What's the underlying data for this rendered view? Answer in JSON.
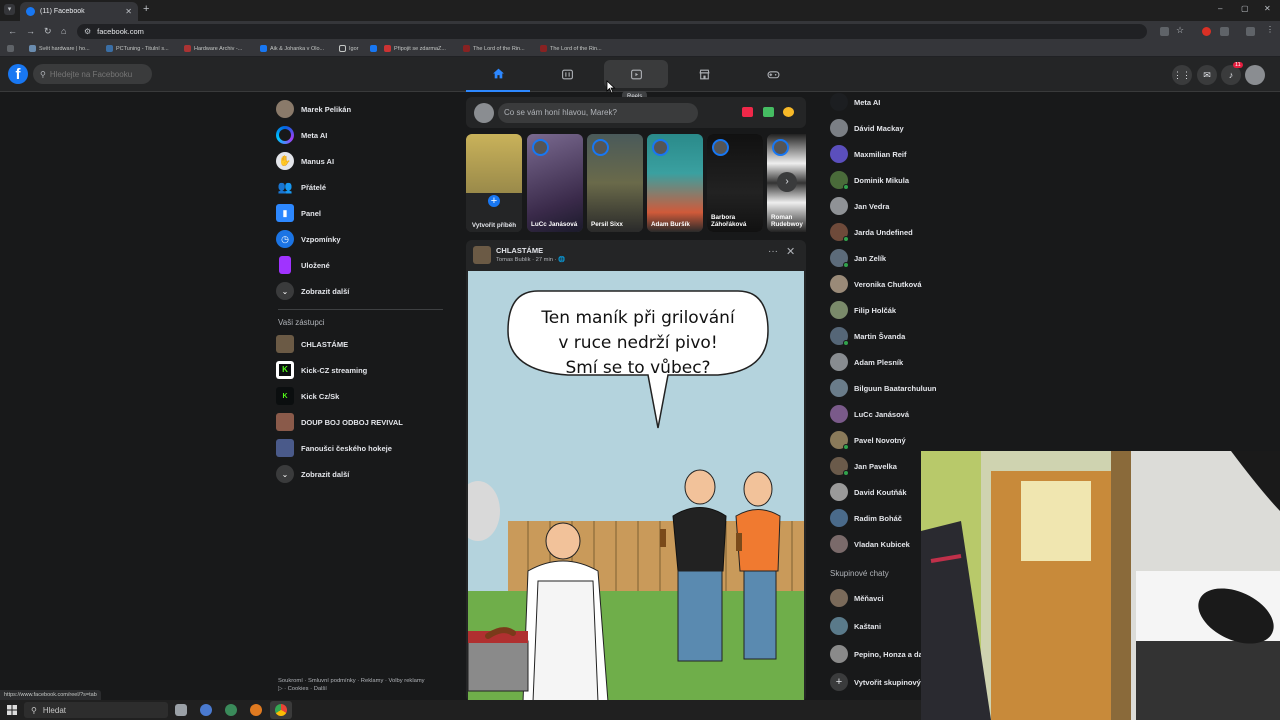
{
  "browser": {
    "tab_title": "(11) Facebook",
    "url": "facebook.com",
    "status_url": "https://www.facebook.com/reel/?s=tab",
    "bookmarks": [
      "Svět hardware | ho...",
      "PCTuning - Titulní s...",
      "Hardware Archiv -...",
      "Aik & Johanka v Olo...",
      "Igor",
      "Připojit se zdarmaZ...",
      "The Lord of the Rin...",
      "The Lord of the Rin..."
    ]
  },
  "header": {
    "search_placeholder": "Hledejte na Facebooku",
    "tooltip": "Reels",
    "notification_count": "11"
  },
  "left_nav": {
    "items": [
      {
        "label": "Marek Pelikán",
        "icon": "avatar"
      },
      {
        "label": "Meta AI",
        "icon": "meta-ai-icon"
      },
      {
        "label": "Manus AI",
        "icon": "manus-icon"
      },
      {
        "label": "Přátelé",
        "icon": "friends-icon"
      },
      {
        "label": "Panel",
        "icon": "panel-icon"
      },
      {
        "label": "Vzpomínky",
        "icon": "memories-icon"
      },
      {
        "label": "Uložené",
        "icon": "saved-icon"
      },
      {
        "label": "Zobrazit další",
        "icon": "chevron-down-icon"
      }
    ],
    "shortcuts_heading": "Vaši zástupci",
    "shortcuts": [
      {
        "label": "CHLASTÁME"
      },
      {
        "label": "Kick-CZ streaming"
      },
      {
        "label": "Kick Cz/Sk"
      },
      {
        "label": "DOUP BOJ ODBOJ REVIVAL"
      },
      {
        "label": "Fanoušci českého hokeje"
      },
      {
        "label": "Zobrazit další"
      }
    ],
    "footer": "Soukromí · Smluvní podmínky · Reklamy · Volby reklamy ▷ · Cookies · Další"
  },
  "composer": {
    "placeholder": "Co se vám honí hlavou, Marek?"
  },
  "stories": [
    {
      "name": "Vytvořit příběh"
    },
    {
      "name": "LuCc Janásová"
    },
    {
      "name": "Persil Sixx"
    },
    {
      "name": "Adam Buršík"
    },
    {
      "name": "Barbora Záhořáková"
    },
    {
      "name": "Roman Rudebwoy"
    }
  ],
  "post": {
    "group": "CHLASTÁME",
    "meta": "Tomas Bublik · 27 min · 🌐",
    "comic_lines": [
      "Ten maník při grilování",
      "v ruce nedrží pivo!",
      "Smí se to vůbec?"
    ]
  },
  "contacts": {
    "items": [
      {
        "name": "Meta AI",
        "online": false,
        "color": "#1c1e21"
      },
      {
        "name": "Dávid Mackay",
        "online": false,
        "color": "#7b7f85"
      },
      {
        "name": "Maxmilian Reif",
        "online": false,
        "color": "#5b4fbd"
      },
      {
        "name": "Dominik Mikula",
        "online": true,
        "color": "#4a6b3a"
      },
      {
        "name": "Jan Vedra",
        "online": false,
        "color": "#8f9296"
      },
      {
        "name": "Jarda Undefined",
        "online": true,
        "color": "#6e4a3a"
      },
      {
        "name": "Jan Zelík",
        "online": true,
        "color": "#5c6b7a"
      },
      {
        "name": "Veronika Chutková",
        "online": false,
        "color": "#9a8a78"
      },
      {
        "name": "Filip Holčák",
        "online": false,
        "color": "#7a8a6a"
      },
      {
        "name": "Martin Švanda",
        "online": true,
        "color": "#556677"
      },
      {
        "name": "Adam Plesník",
        "online": false,
        "color": "#888c90"
      },
      {
        "name": "Bilguun Baatarchuluun",
        "online": false,
        "color": "#6a7c8a"
      },
      {
        "name": "LuCc Janásová",
        "online": false,
        "color": "#7a5a8a"
      },
      {
        "name": "Pavel Novotný",
        "online": true,
        "color": "#8a7a5a"
      },
      {
        "name": "Jan Pavelka",
        "online": true,
        "color": "#6a5a4a"
      },
      {
        "name": "David Koutňák",
        "online": false,
        "color": "#9a9a9a"
      },
      {
        "name": "Radim Boháč",
        "online": false,
        "color": "#4a6a8a"
      },
      {
        "name": "Vladan Kubicek",
        "online": false,
        "color": "#7a6a6a"
      }
    ],
    "group_heading": "Skupinové chaty",
    "groups": [
      {
        "name": "Měňavci"
      },
      {
        "name": "Kaštani"
      },
      {
        "name": "Pepino, Honza a dal"
      },
      {
        "name": "Vytvořit skupinový c"
      }
    ]
  },
  "taskbar": {
    "search_placeholder": "Hledat"
  },
  "colors": {
    "fb_blue": "#1877f2",
    "bg": "#18191a",
    "card": "#242526",
    "online": "#31a24c"
  }
}
